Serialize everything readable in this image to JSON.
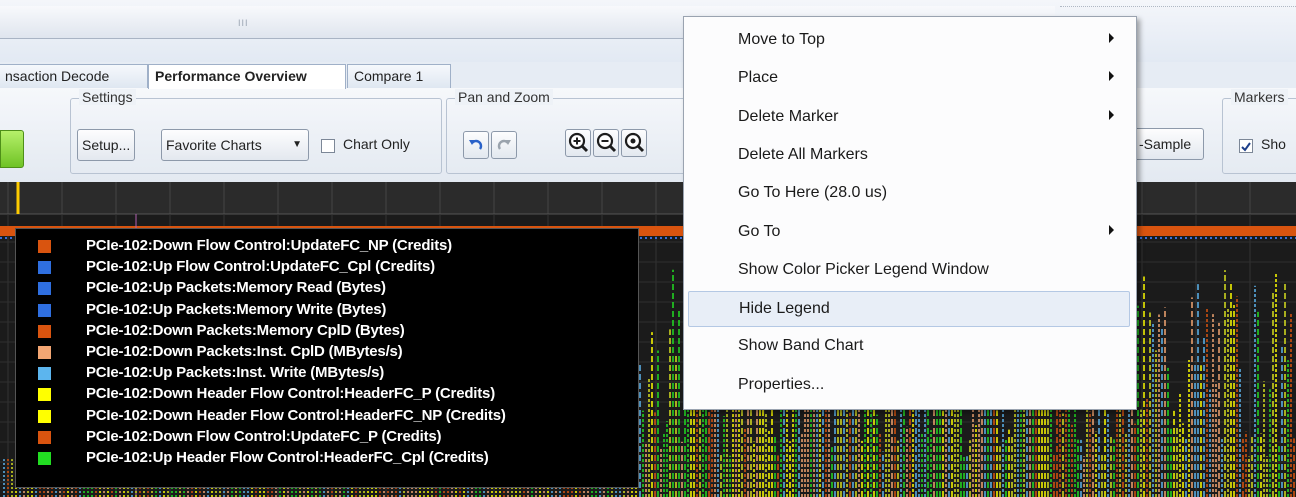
{
  "window": {
    "splitter_grip": "III"
  },
  "tabs": [
    {
      "label": "nsaction Decode"
    },
    {
      "label": "Performance Overview",
      "active": true
    },
    {
      "label": "Compare 1"
    }
  ],
  "ribbon": {
    "settings": {
      "title": "Settings",
      "setup_label": "Setup...",
      "favorite_label": "Favorite Charts",
      "chart_only_label": "Chart Only",
      "chart_only_checked": false
    },
    "pan_zoom": {
      "title": "Pan and Zoom"
    },
    "sample_label": "-Sample",
    "markers": {
      "title": "Markers",
      "show_label": "Sho",
      "show_checked": true
    }
  },
  "legend": {
    "items": [
      {
        "label": "PCIe-102:Down Flow Control:UpdateFC_NP (Credits)",
        "color": "#d9540f"
      },
      {
        "label": "PCIe-102:Up Flow Control:UpdateFC_Cpl (Credits)",
        "color": "#2f6fe0"
      },
      {
        "label": "PCIe-102:Up Packets:Memory Read (Bytes)",
        "color": "#2f6fe0"
      },
      {
        "label": "PCIe-102:Up Packets:Memory Write (Bytes)",
        "color": "#2f6fe0"
      },
      {
        "label": "PCIe-102:Down Packets:Memory CplD (Bytes)",
        "color": "#d9540f"
      },
      {
        "label": "PCIe-102:Down Packets:Inst. CplD (MBytes/s)",
        "color": "#f3a673"
      },
      {
        "label": "PCIe-102:Up Packets:Inst. Write (MBytes/s)",
        "color": "#5cb5ee"
      },
      {
        "label": "PCIe-102:Down Header Flow Control:HeaderFC_P (Credits)",
        "color": "#ffff00"
      },
      {
        "label": "PCIe-102:Down Header Flow Control:HeaderFC_NP (Credits)",
        "color": "#ffff00"
      },
      {
        "label": "PCIe-102:Down Flow Control:UpdateFC_P (Credits)",
        "color": "#d9540f"
      },
      {
        "label": "PCIe-102:Up Header Flow Control:HeaderFC_Cpl (Credits)",
        "color": "#22dd22"
      }
    ]
  },
  "context_menu": {
    "items": [
      {
        "label": "Move to Top",
        "submenu": true
      },
      {
        "label": "Place",
        "submenu": true
      },
      {
        "label": "Delete Marker",
        "submenu": true
      },
      {
        "label": "Delete All Markers",
        "submenu": false
      },
      {
        "label": "Go To Here (28.0 us)",
        "submenu": false
      },
      {
        "label": "Go To",
        "submenu": true
      },
      {
        "label": "Show Color Picker Legend Window",
        "submenu": false
      },
      {
        "label": "Hide Legend",
        "submenu": false,
        "highlighted": true
      },
      {
        "label": "Show Band Chart",
        "submenu": false
      },
      {
        "label": "Properties...",
        "submenu": false
      }
    ]
  },
  "colors": {
    "plot_bg": "#1b1b1b",
    "orange_band": "#d9540f",
    "marker": "#ffcc00"
  }
}
